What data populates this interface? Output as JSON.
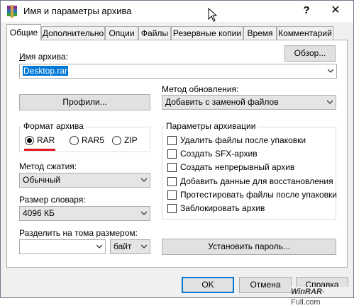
{
  "window": {
    "title": "Имя и параметры архива",
    "help_glyph": "?",
    "close_glyph": "✕"
  },
  "tabs": [
    "Общие",
    "Дополнительно",
    "Опции",
    "Файлы",
    "Резервные копии",
    "Время",
    "Комментарий"
  ],
  "archive_name": {
    "label": "Имя архива:",
    "value": "Desktop.rar",
    "browse_label": "Обзор..."
  },
  "profiles_label": "Профили...",
  "update_method": {
    "label": "Метод обновления:",
    "value": "Добавить с заменой файлов"
  },
  "archive_format": {
    "title": "Формат архива",
    "options": [
      "RAR",
      "RAR5",
      "ZIP"
    ],
    "selected": "RAR"
  },
  "compression": {
    "label": "Метод сжатия:",
    "value": "Обычный"
  },
  "dictionary": {
    "label": "Размер словаря:",
    "value": "4096 КБ"
  },
  "split": {
    "label": "Разделить на тома размером:",
    "value": "",
    "unit": "байт"
  },
  "archive_options": {
    "title": "Параметры архивации",
    "items": [
      {
        "label": "Удалить файлы после упаковки",
        "checked": false
      },
      {
        "label": "Создать SFX-архив",
        "checked": false
      },
      {
        "label": "Создать непрерывный архив",
        "checked": false
      },
      {
        "label": "Добавить данные для восстановления",
        "checked": false
      },
      {
        "label": "Протестировать файлы после упаковки",
        "checked": false
      },
      {
        "label": "Заблокировать архив",
        "checked": false
      }
    ]
  },
  "set_password_label": "Установить пароль...",
  "buttons": {
    "ok": "OK",
    "cancel": "Отмена",
    "help": "Справка"
  },
  "watermark": {
    "brand": "WinRAR",
    "suffix": "-Full.com"
  },
  "colors": {
    "accent": "#0078d7",
    "highlight_line": "#e0141e"
  }
}
